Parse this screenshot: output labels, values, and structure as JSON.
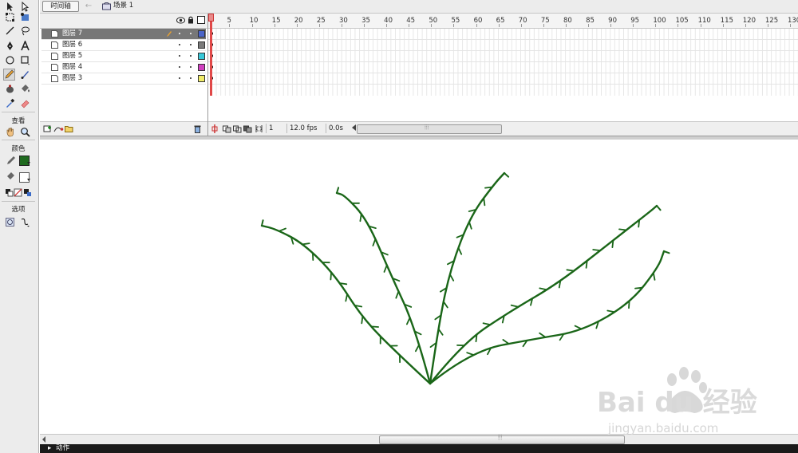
{
  "toolbox": {
    "view_label": "查看",
    "color_label": "颜色",
    "options_label": "选项",
    "stroke_color": "#1f6a1f",
    "fill_color": "#ffffff"
  },
  "timeline": {
    "tab_label": "时间轴",
    "scene_label": "场景 1",
    "layers": [
      {
        "name": "图层 7",
        "color": "#4a64c8",
        "selected": true
      },
      {
        "name": "图层 6",
        "color": "#7a7a7a",
        "selected": false
      },
      {
        "name": "图层 5",
        "color": "#38c8d8",
        "selected": false
      },
      {
        "name": "图层 4",
        "color": "#d040c0",
        "selected": false
      },
      {
        "name": "图层 3",
        "color": "#f0ec68",
        "selected": false
      }
    ],
    "ruler_numbers": [
      "5",
      "10",
      "15",
      "20",
      "25",
      "30",
      "35",
      "40",
      "45",
      "50",
      "55",
      "60",
      "65",
      "70",
      "75",
      "80",
      "85",
      "90",
      "95",
      "100",
      "105",
      "110",
      "115",
      "120",
      "125",
      "130"
    ],
    "current_frame": "1",
    "frame_rate": "12.0 fps",
    "elapsed_time": "0.0s"
  },
  "panel": {
    "actions_label": "动作"
  },
  "colors": {
    "drawing": "#1a6618",
    "ui_bg": "#ececec"
  },
  "watermark": {
    "brand_text": "Bai du 经验",
    "url_text": "jingyan.baidu.com"
  }
}
